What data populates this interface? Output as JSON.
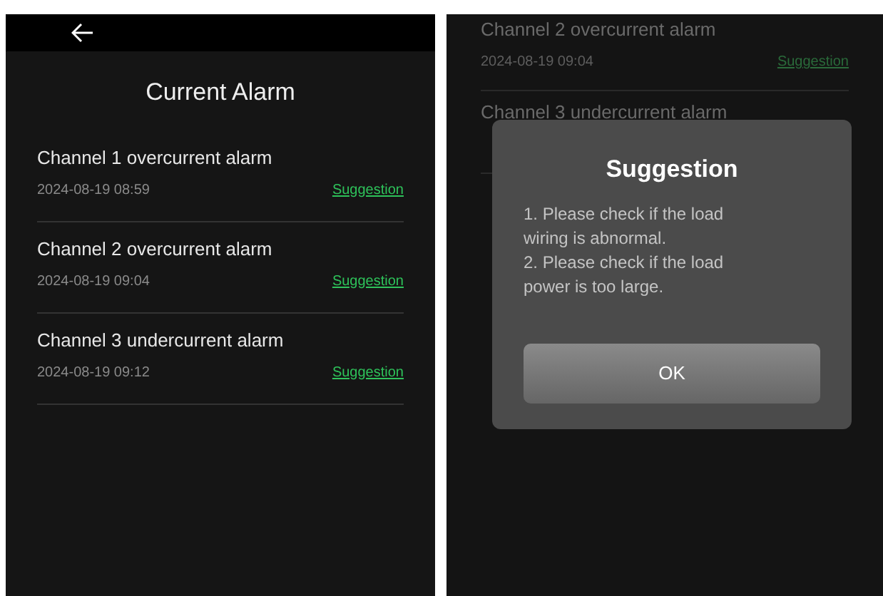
{
  "left_screen": {
    "title": "Current Alarm",
    "alarms": [
      {
        "name": "Channel 1 overcurrent alarm",
        "time": "2024-08-19 08:59",
        "action": "Suggestion"
      },
      {
        "name": "Channel 2 overcurrent alarm",
        "time": "2024-08-19 09:04",
        "action": "Suggestion"
      },
      {
        "name": "Channel 3 undercurrent alarm",
        "time": "2024-08-19 09:12",
        "action": "Suggestion"
      }
    ]
  },
  "right_screen": {
    "alarms": [
      {
        "name": "Channel 2 overcurrent alarm",
        "time": "2024-08-19 09:04",
        "action": "Suggestion"
      },
      {
        "name": "Channel 3 undercurrent alarm"
      }
    ],
    "dialog": {
      "title": "Suggestion",
      "lines": [
        "1. Please check if the load wiring is abnormal.",
        "2. Please check if the load power is too large."
      ],
      "button": "OK"
    }
  }
}
